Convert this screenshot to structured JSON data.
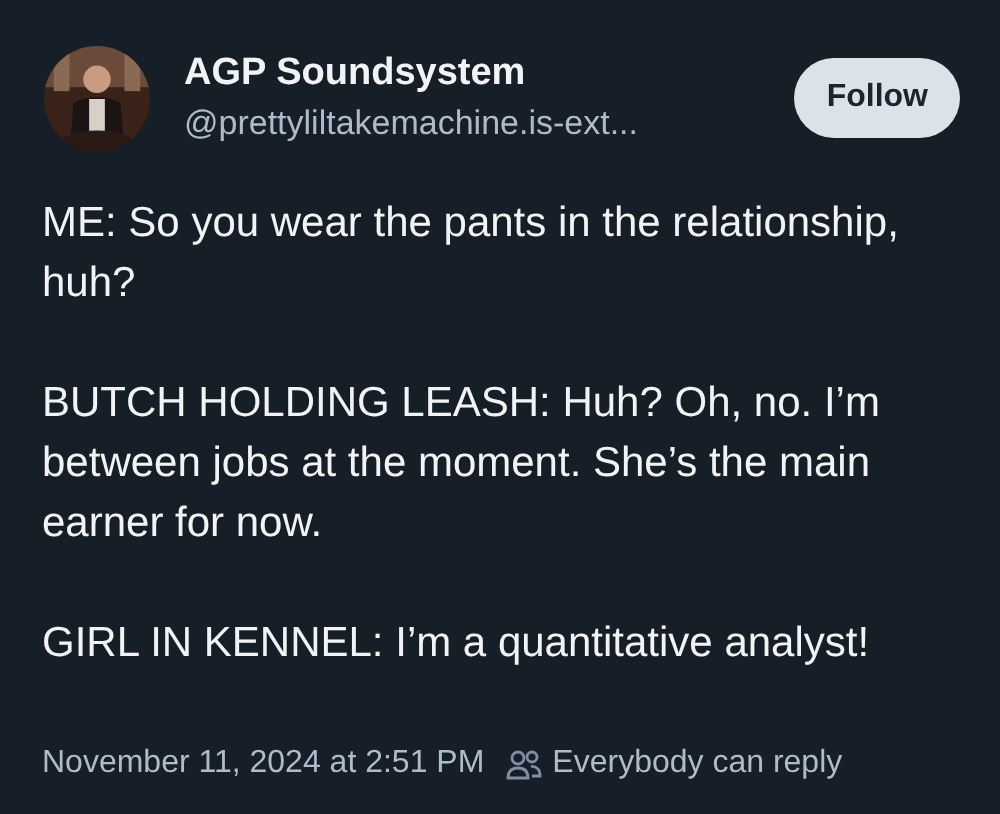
{
  "author": {
    "name": "AGP Soundsystem",
    "handle": "@prettyliltakemachine.is-ext..."
  },
  "follow_button": {
    "label": "Follow"
  },
  "paragraphs": [
    "ME: So you wear the pants in the relationship, huh?",
    "BUTCH HOLDING LEASH: Huh? Oh, no. I’m between jobs at the moment. She’s the main earner for now.",
    "GIRL IN KENNEL: I’m a quantitative analyst!"
  ],
  "footer": {
    "timestamp": "November 11, 2024 at 2:51 PM",
    "reply_setting": "Everybody can reply"
  }
}
